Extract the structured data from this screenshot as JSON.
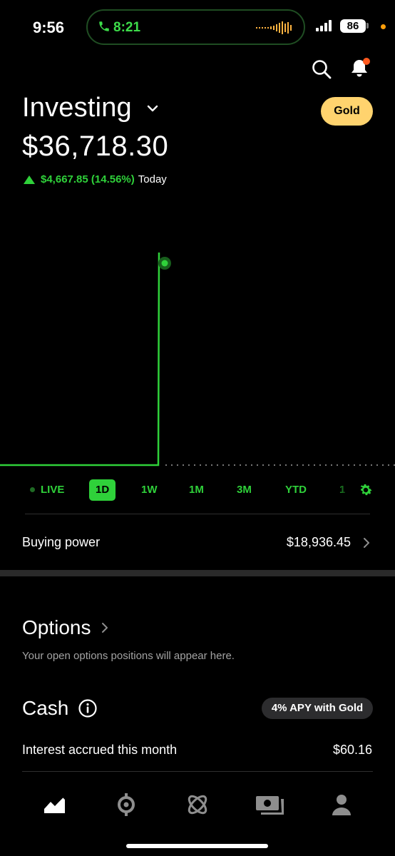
{
  "status_bar": {
    "time": "9:56",
    "call_time": "8:21",
    "battery": "86",
    "call_color": "#3ddc4a",
    "mic_indicator_color": "#ff9f0a"
  },
  "header": {
    "search_icon": "search-icon",
    "notifications_icon": "bell-icon",
    "notification_dot_color": "#ff5a1f"
  },
  "account": {
    "title": "Investing",
    "gold_label": "Gold",
    "gold_color": "#ffd36e",
    "portfolio_value": "$36,718.30",
    "change_value": "$4,667.85 (14.56%)",
    "change_period": "Today",
    "accent_color": "#2fd13a"
  },
  "range_selector": {
    "live_label": "LIVE",
    "items": [
      "1D",
      "1W",
      "1M",
      "3M",
      "YTD",
      "1"
    ],
    "selected": "1D",
    "settings_icon": "gear-icon"
  },
  "buying_power": {
    "label": "Buying power",
    "value": "$18,936.45"
  },
  "options": {
    "title": "Options",
    "description": "Your open options positions will appear here."
  },
  "cash": {
    "title": "Cash",
    "apy_badge": "4% APY with Gold",
    "interest_label": "Interest accrued this month",
    "interest_value": "$60.16"
  },
  "bottom_nav": {
    "items": [
      "investing-chart-icon",
      "crypto-icon",
      "retirement-icon",
      "spending-card-icon",
      "account-icon"
    ]
  }
}
